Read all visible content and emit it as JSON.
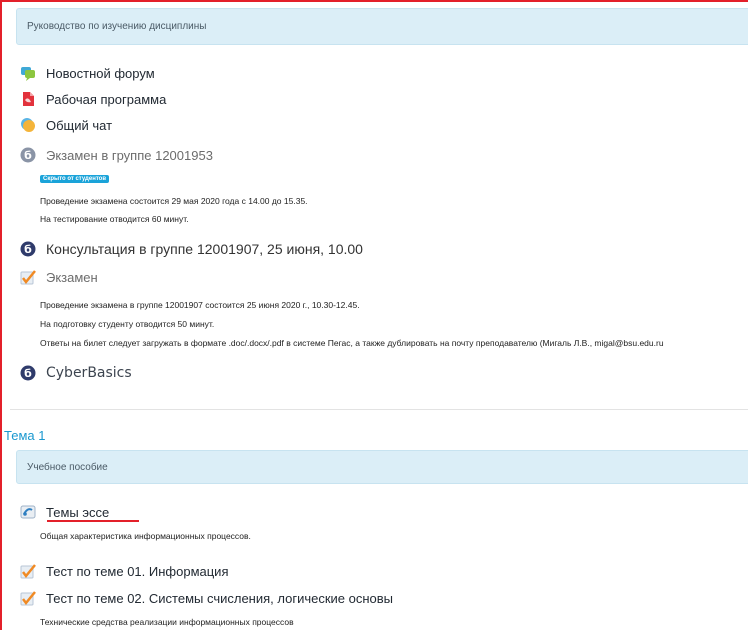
{
  "summary": {
    "text": "Руководство по изучению дисциплины"
  },
  "activities": {
    "news_forum": "Новостной форум",
    "work_program": "Рабочая программа",
    "general_chat": "Общий чат",
    "exam_group": "Экзамен в группе 12001953",
    "hidden_badge": "Скрыто от студентов",
    "exam_group_desc_1": "Проведение экзамена состоится 29 мая 2020 года с 14.00 до 15.35.",
    "exam_group_desc_2": "На тестирование отводится 60 минут.",
    "consultation": "Консультация в группе 12001907, 25 июня, 10.00",
    "exam": "Экзамен",
    "exam_desc_1": "Проведение экзамена в группе 12001907 состоится 25 июня 2020 г., 10.30-12.45.",
    "exam_desc_2": "На подготовку студенту отводится 50 минут.",
    "exam_desc_3": "Ответы на билет следует загружать в формате .doc/.docx/.pdf в системе Пегас, а также дублировать на почту преподавателю (Мигаль Л.В., migal@bsu.edu.ru",
    "cyberbasics": "CyberBasics"
  },
  "topic1": {
    "title": "Тема 1",
    "summary": "Учебное пособие",
    "essay_topics": "Темы эссе",
    "essay_desc": "Общая характеристика информационных процессов.",
    "test_01": "Тест по теме 01. Информация",
    "test_02": "Тест по теме 02. Системы счисления, логические основы",
    "tech_text": "Технические средства реализации информационных процессов"
  },
  "colors": {
    "accent_red": "#e3202a",
    "section_blue": "#1a98cf",
    "infobox_bg": "#dbeef7",
    "badge_blue": "#1aa3d9"
  },
  "icons": {
    "forum": "forum-icon",
    "pdf": "pdf-icon",
    "chat": "chat-icon",
    "test": "test-icon",
    "quiz": "quiz-check-icon",
    "url": "url-icon"
  }
}
